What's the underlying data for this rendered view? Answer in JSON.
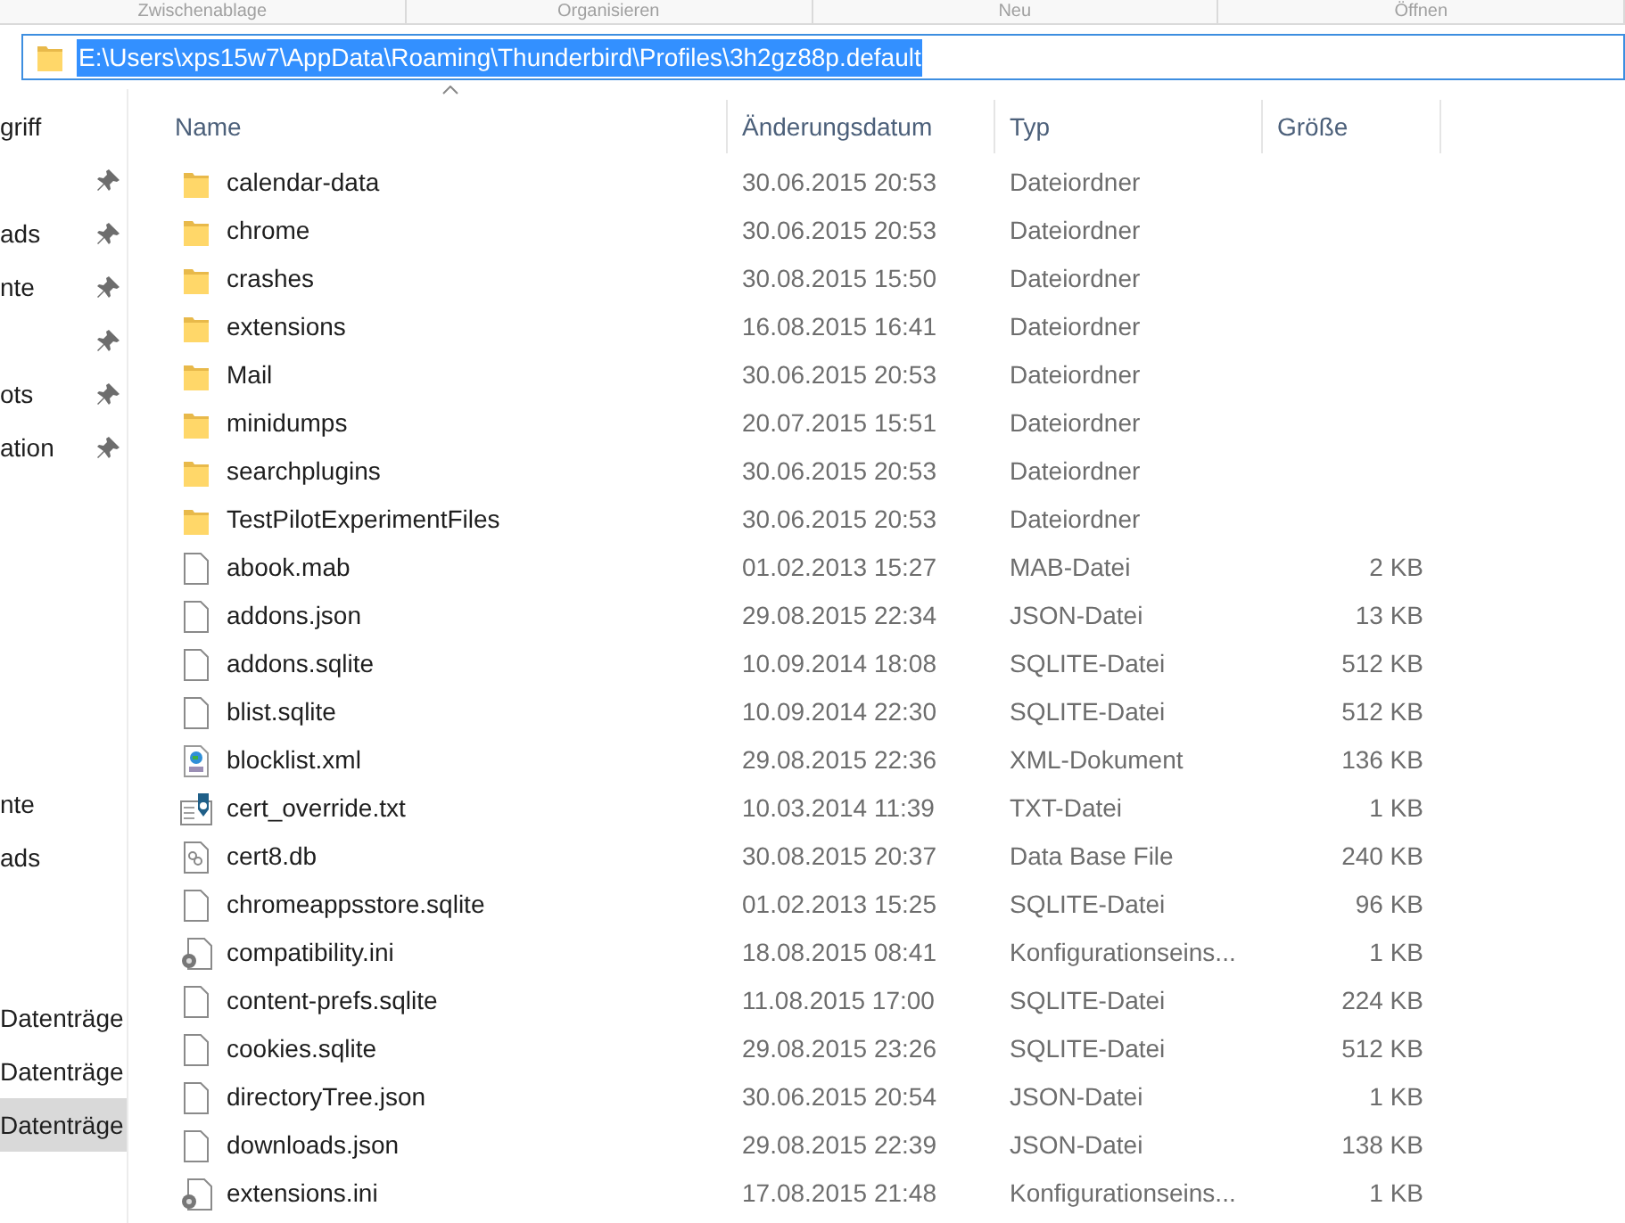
{
  "ribbon_groups": [
    "Zwischenablage",
    "Organisieren",
    "Neu",
    "Öffnen"
  ],
  "address_bar": {
    "path": "E:\\Users\\xps15w7\\AppData\\Roaming\\Thunderbird\\Profiles\\3h2gz88p.default",
    "selected": true
  },
  "sidebar": {
    "groups": [
      [
        {
          "label": "griff",
          "pinned": false,
          "selected": false
        },
        {
          "pinned": true,
          "selected": false
        },
        {
          "label": "ads",
          "pinned": true,
          "selected": false
        },
        {
          "label": "nte",
          "pinned": true,
          "selected": false
        },
        {
          "pinned": true,
          "selected": false
        },
        {
          "label": "ots",
          "pinned": true,
          "selected": false
        },
        {
          "label": "ation",
          "pinned": true,
          "selected": false
        }
      ],
      [
        {
          "label": "nte",
          "pinned": false,
          "selected": false
        },
        {
          "label": "ads",
          "pinned": false,
          "selected": false
        }
      ],
      [
        {
          "label": "Datenträge",
          "pinned": false,
          "selected": false
        },
        {
          "label": "Datenträge",
          "pinned": false,
          "selected": false
        },
        {
          "label": "Datenträge",
          "pinned": false,
          "selected": true
        }
      ]
    ]
  },
  "table": {
    "columns": [
      "Name",
      "Änderungsdatum",
      "Typ",
      "Größe"
    ],
    "rows": [
      {
        "kind": "folder",
        "name": "calendar-data",
        "date": "30.06.2015 20:53",
        "type": "Dateiordner"
      },
      {
        "kind": "folder",
        "name": "chrome",
        "date": "30.06.2015 20:53",
        "type": "Dateiordner"
      },
      {
        "kind": "folder",
        "name": "crashes",
        "date": "30.08.2015 15:50",
        "type": "Dateiordner"
      },
      {
        "kind": "folder",
        "name": "extensions",
        "date": "16.08.2015 16:41",
        "type": "Dateiordner"
      },
      {
        "kind": "folder",
        "name": "Mail",
        "date": "30.06.2015 20:53",
        "type": "Dateiordner"
      },
      {
        "kind": "folder",
        "name": "minidumps",
        "date": "20.07.2015 15:51",
        "type": "Dateiordner"
      },
      {
        "kind": "folder",
        "name": "searchplugins",
        "date": "30.06.2015 20:53",
        "type": "Dateiordner"
      },
      {
        "kind": "folder",
        "name": "TestPilotExperimentFiles",
        "date": "30.06.2015 20:53",
        "type": "Dateiordner"
      },
      {
        "kind": "file",
        "name": "abook.mab",
        "date": "01.02.2013 15:27",
        "type": "MAB-Datei",
        "size": "2 KB"
      },
      {
        "kind": "file",
        "name": "addons.json",
        "date": "29.08.2015 22:34",
        "type": "JSON-Datei",
        "size": "13 KB"
      },
      {
        "kind": "file",
        "name": "addons.sqlite",
        "date": "10.09.2014 18:08",
        "type": "SQLITE-Datei",
        "size": "512 KB"
      },
      {
        "kind": "file",
        "name": "blist.sqlite",
        "date": "10.09.2014 22:30",
        "type": "SQLITE-Datei",
        "size": "512 KB"
      },
      {
        "kind": "xml",
        "name": "blocklist.xml",
        "date": "29.08.2015 22:36",
        "type": "XML-Dokument",
        "size": "136 KB"
      },
      {
        "kind": "cert",
        "name": "cert_override.txt",
        "date": "10.03.2014 11:39",
        "type": "TXT-Datei",
        "size": "1 KB"
      },
      {
        "kind": "db",
        "name": "cert8.db",
        "date": "30.08.2015 20:37",
        "type": "Data Base File",
        "size": "240 KB"
      },
      {
        "kind": "file",
        "name": "chromeappsstore.sqlite",
        "date": "01.02.2013 15:25",
        "type": "SQLITE-Datei",
        "size": "96 KB"
      },
      {
        "kind": "ini",
        "name": "compatibility.ini",
        "date": "18.08.2015 08:41",
        "type": "Konfigurationseins...",
        "size": "1 KB"
      },
      {
        "kind": "file",
        "name": "content-prefs.sqlite",
        "date": "11.08.2015 17:00",
        "type": "SQLITE-Datei",
        "size": "224 KB"
      },
      {
        "kind": "file",
        "name": "cookies.sqlite",
        "date": "29.08.2015 23:26",
        "type": "SQLITE-Datei",
        "size": "512 KB"
      },
      {
        "kind": "file",
        "name": "directoryTree.json",
        "date": "30.06.2015 20:54",
        "type": "JSON-Datei",
        "size": "1 KB"
      },
      {
        "kind": "file",
        "name": "downloads.json",
        "date": "29.08.2015 22:39",
        "type": "JSON-Datei",
        "size": "138 KB"
      },
      {
        "kind": "ini",
        "name": "extensions.ini",
        "date": "17.08.2015 21:48",
        "type": "Konfigurationseins...",
        "size": "1 KB"
      }
    ]
  }
}
